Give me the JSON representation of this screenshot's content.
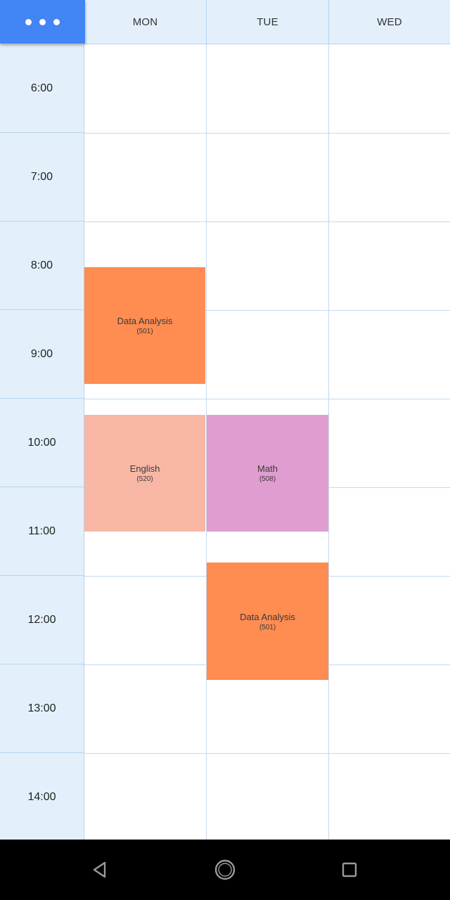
{
  "header": {
    "menu_icon": "more-horizontal-icon",
    "days": [
      "MON",
      "TUE",
      "WED"
    ]
  },
  "times": [
    "6:00",
    "7:00",
    "8:00",
    "9:00",
    "10:00",
    "11:00",
    "12:00",
    "13:00",
    "14:00"
  ],
  "classes": [
    {
      "name": "Data Analysis",
      "room": "(501)",
      "day": "MON",
      "color": "#ff8c50"
    },
    {
      "name": "English",
      "room": "(520)",
      "day": "MON",
      "color": "#f8b7a5"
    },
    {
      "name": "Math",
      "room": "(508)",
      "day": "TUE",
      "color": "#e09dd0"
    },
    {
      "name": "Data Analysis",
      "room": "(501)",
      "day": "TUE",
      "color": "#ff8c50"
    }
  ],
  "colors": {
    "accent": "#4285f4",
    "header_bg": "#e3f0fc",
    "grid_line": "#c3d9ee"
  },
  "navbar": {
    "back_icon": "triangle-back-icon",
    "home_icon": "circle-home-icon",
    "recents_icon": "square-recents-icon"
  }
}
